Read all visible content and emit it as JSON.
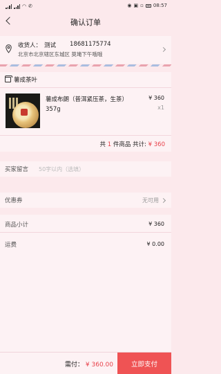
{
  "statusbar": {
    "signal_left": "ᴴᴰ",
    "time": "08:57"
  },
  "navbar": {
    "title": "确认订单"
  },
  "address": {
    "receiver_label": "收货人：",
    "receiver_name": "测试",
    "phone": "18681175774",
    "full_address": "北京市北京辖区东城区 莫埯下午哦哦"
  },
  "shop": {
    "name": "薯成茶叶",
    "product": {
      "name": "薯成布朗（普洱紧压茶，生茶）357g",
      "price": "¥ 360",
      "quantity": "x1"
    },
    "summary_prefix": "共",
    "summary_count": "1",
    "summary_mid": "件商品 共计:",
    "summary_total": "¥ 360"
  },
  "remark": {
    "label": "买家留言",
    "placeholder": "50字以内（选填）"
  },
  "coupon": {
    "label": "优惠券",
    "value": "无可用"
  },
  "totals": {
    "subtotal_label": "商品小计",
    "subtotal_value": "¥ 360",
    "shipping_label": "运费",
    "shipping_value": "¥ 0.00"
  },
  "bottombar": {
    "need_pay_label": "需付：",
    "need_pay_amount": "¥ 360.00",
    "pay_button": "立即支付"
  },
  "colors": {
    "accent": "#ef5354",
    "price_red": "#e8414a",
    "background": "#fce9ec"
  }
}
